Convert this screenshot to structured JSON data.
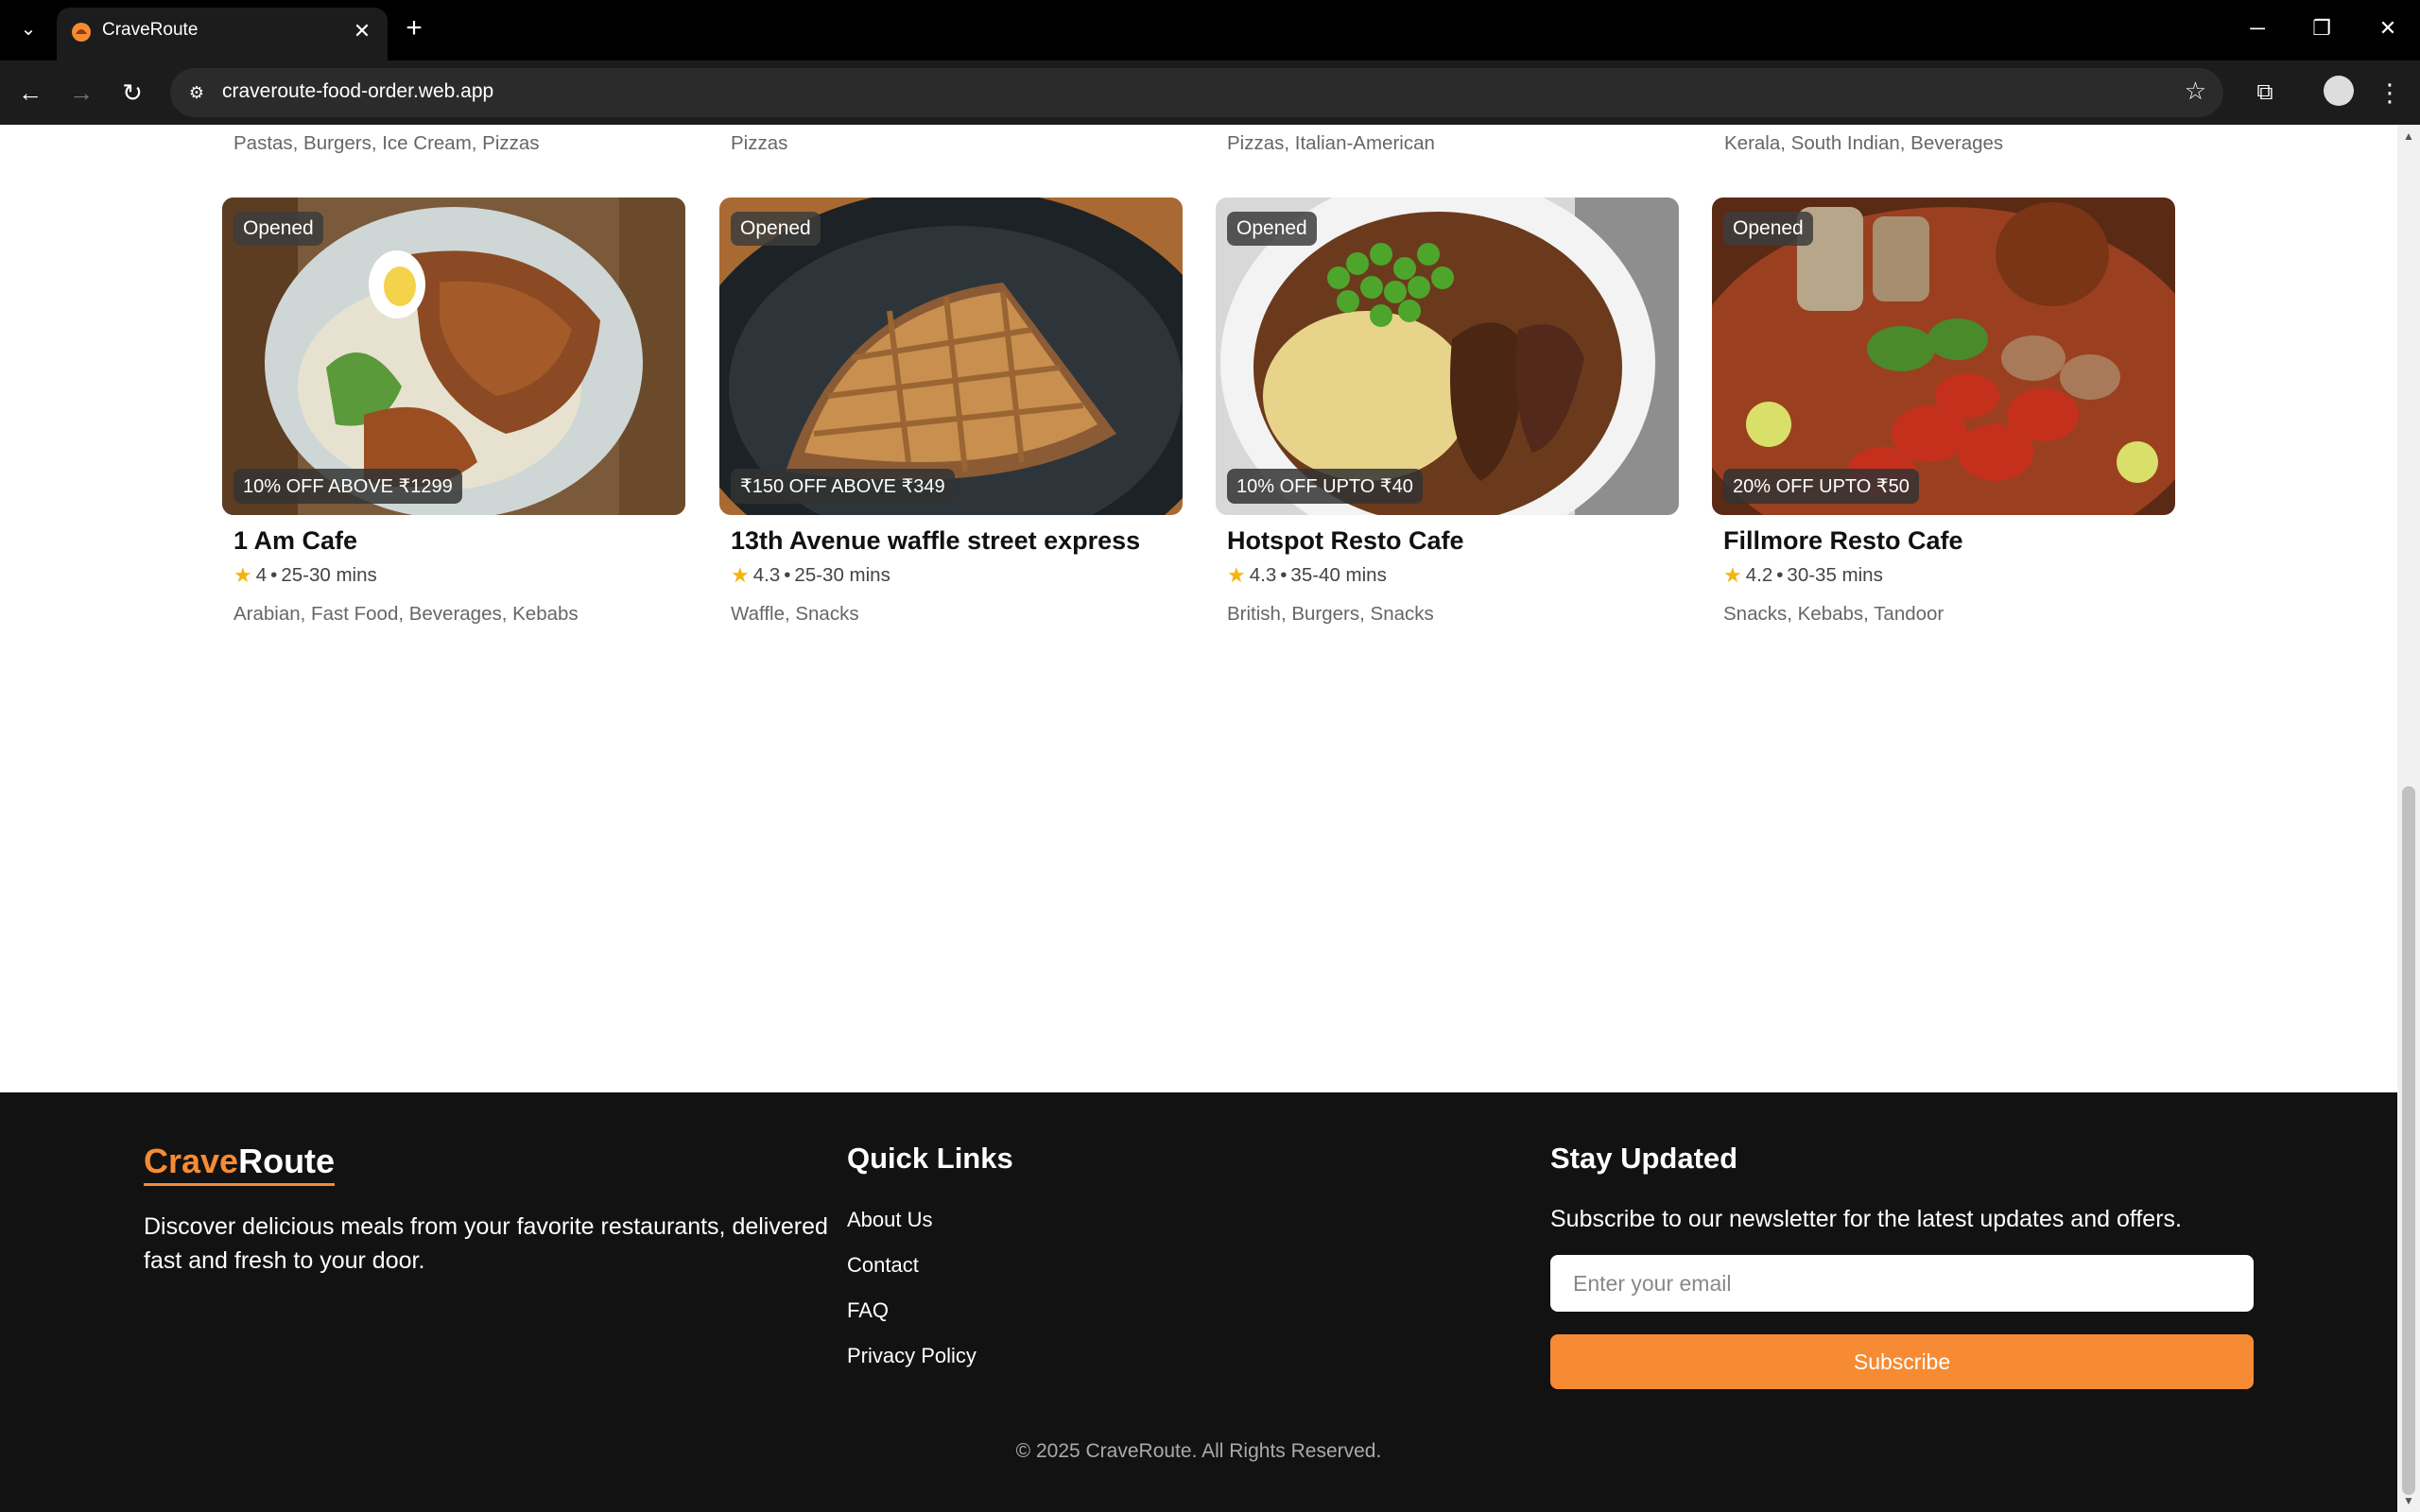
{
  "browser": {
    "tab_title": "CraveRoute",
    "url": "craveroute-food-order.web.app"
  },
  "previous_row": {
    "cuisines": [
      "Pastas, Burgers, Ice Cream, Pizzas",
      "Pizzas",
      "Pizzas, Italian-American",
      "Kerala, South Indian, Beverages"
    ]
  },
  "restaurants": [
    {
      "name": "1 Am Cafe",
      "status": "Opened",
      "offer": "10% OFF ABOVE ₹1299",
      "rating": "4",
      "time": "25-30 mins",
      "cuisines": "Arabian, Fast Food, Beverages, Kebabs"
    },
    {
      "name": "13th Avenue waffle street express",
      "status": "Opened",
      "offer": "₹150 OFF ABOVE ₹349",
      "rating": "4.3",
      "time": "25-30 mins",
      "cuisines": "Waffle, Snacks"
    },
    {
      "name": "Hotspot Resto Cafe",
      "status": "Opened",
      "offer": "10% OFF UPTO ₹40",
      "rating": "4.3",
      "time": "35-40 mins",
      "cuisines": "British, Burgers, Snacks"
    },
    {
      "name": "Fillmore Resto Cafe",
      "status": "Opened",
      "offer": "20% OFF UPTO ₹50",
      "rating": "4.2",
      "time": "30-35 mins",
      "cuisines": "Snacks, Kebabs, Tandoor"
    }
  ],
  "meta_separator": "•",
  "footer": {
    "brand_part1": "Crave",
    "brand_part2": "Route",
    "description": "Discover delicious meals from your favorite restaurants, delivered fast and fresh to your door.",
    "quick_links_title": "Quick Links",
    "quick_links": [
      "About Us",
      "Contact",
      "FAQ",
      "Privacy Policy"
    ],
    "stay_updated_title": "Stay Updated",
    "stay_updated_desc": "Subscribe to our newsletter for the latest updates and offers.",
    "email_placeholder": "Enter your email",
    "subscribe_label": "Subscribe",
    "copyright": "© 2025 CraveRoute. All Rights Reserved."
  },
  "colors": {
    "accent": "#f68b33",
    "footer_bg": "#121212",
    "star": "#f5b40b"
  }
}
